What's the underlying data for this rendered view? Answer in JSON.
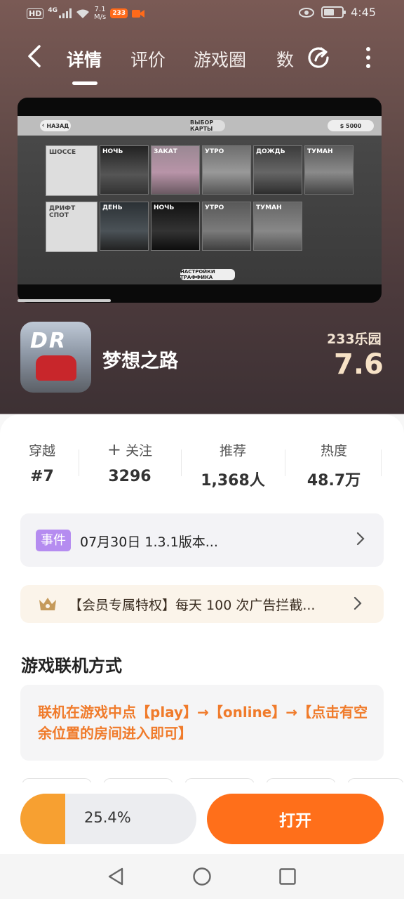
{
  "status_bar": {
    "network": "HD",
    "signal": "4G",
    "speed_value": "7.1",
    "speed_unit": "M/s",
    "app_badge": "233",
    "time": "4:45"
  },
  "nav": {
    "tabs": [
      "详情",
      "评价",
      "游戏圈",
      "数"
    ],
    "active_tab": "详情"
  },
  "screenshot": {
    "back_label": "НАЗАД",
    "title": "ВЫБОР КАРТЫ",
    "money": "$ 5000",
    "row1_label": "ШОССЕ",
    "row1_items": [
      "НОЧЬ",
      "ЗАКАТ",
      "УТРО",
      "ДОЖДЬ",
      "ТУМАН"
    ],
    "row2_label": "ДРИФТ СПОТ",
    "row2_items": [
      "ДЕНЬ",
      "НОЧЬ",
      "УТРО",
      "ТУМАН"
    ],
    "traffic_button": "НАСТРОЙКИ ТРАФФИКА",
    "carousel_position": 0.26
  },
  "app": {
    "icon_text": "DR",
    "name": "梦想之路",
    "platform": "233乐园",
    "score": "7.6"
  },
  "stats": [
    {
      "label": "穿越",
      "value": "#7"
    },
    {
      "label": "关注",
      "value": "3296"
    },
    {
      "label": "推荐",
      "value": "1,368人"
    },
    {
      "label": "热度",
      "value": "48.7万"
    }
  ],
  "event": {
    "tag": "事件",
    "text": "07月30日  1.3.1版本..."
  },
  "vip": {
    "text": "【会员专属特权】每天 100 次广告拦截..."
  },
  "online": {
    "title": "游戏联机方式",
    "text": "联机在游戏中点【play】→【online】→【点击有空余位置的房间进入即可】"
  },
  "download": {
    "progress_text": "25.4%",
    "progress": 0.254,
    "open_label": "打开"
  },
  "colors": {
    "accent": "#ff6f1a",
    "progress": "#f7a031",
    "event_tag": "#b58cf0",
    "online_text": "#f07b2b"
  }
}
